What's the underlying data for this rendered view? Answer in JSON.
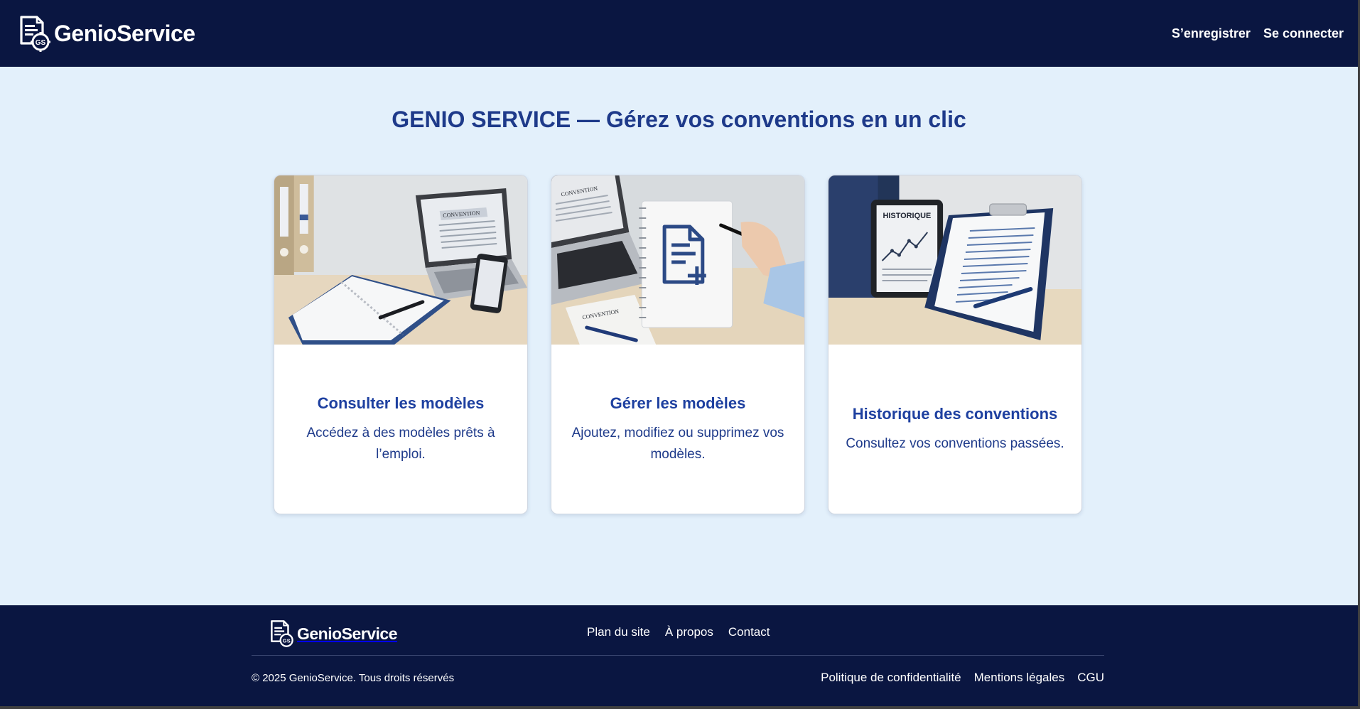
{
  "header": {
    "logo_text": "GenioService",
    "nav": {
      "register": "S’enregistrer",
      "login": "Se connecter"
    }
  },
  "main": {
    "title": "GENIO SERVICE — Gérez vos conventions en un clic",
    "cards": [
      {
        "title": "Consulter les modèles",
        "description": "Accédez à des modèles prêts à l’emploi.",
        "image_labels": [
          "CONVENTION",
          "CONVENTION"
        ]
      },
      {
        "title": "Gérer les modèles",
        "description": "Ajoutez, modifiez ou supprimez vos modèles.",
        "image_labels": [
          "CONVENTION",
          "CONVENTION"
        ]
      },
      {
        "title": "Historique des conventions",
        "description": "Consultez vos conventions passées.",
        "image_labels": [
          "HISTORIQUE"
        ]
      }
    ]
  },
  "footer": {
    "logo_text": "GenioService",
    "links": [
      "Plan du site",
      "À propos",
      "Contact"
    ],
    "copyright": "© 2025 GenioService. Tous droits réservés",
    "legal": [
      "Politique de confidentialité",
      "Mentions légales",
      "CGU"
    ]
  },
  "colors": {
    "navy": "#0a1641",
    "background": "#e3f0fb",
    "accent": "#1e40a0"
  }
}
